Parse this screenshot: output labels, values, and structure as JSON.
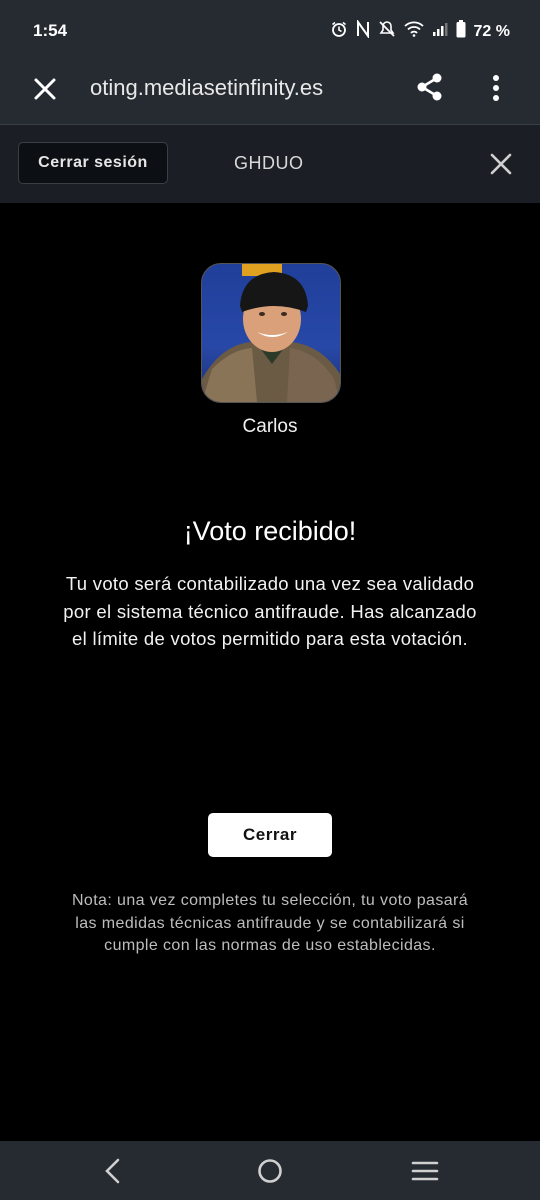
{
  "status_bar": {
    "time": "1:54",
    "battery_percent": "72 %",
    "icons": [
      "alarm-icon",
      "nfc-icon",
      "mute-icon",
      "wifi-icon",
      "signal-icon",
      "battery-icon"
    ]
  },
  "browser": {
    "url": "oting.mediasetinfinity.es",
    "icons": [
      "close-icon",
      "share-icon",
      "more-vert-icon"
    ]
  },
  "site_header": {
    "logout_label": "Cerrar sesión",
    "program": "GHDUO"
  },
  "candidate": {
    "name": "Carlos"
  },
  "confirmation": {
    "title": "¡Voto recibido!",
    "message": "Tu voto será contabilizado una vez sea validado por el sistema técnico antifraude. Has alcanzado el límite de votos permitido para esta votación.",
    "close_label": "Cerrar",
    "note": "Nota: una vez completes tu selección, tu voto pasará las medidas técnicas antifraude y se contabilizará si cumple con las normas de uso establecidas."
  },
  "nav_bar": {
    "icons": [
      "back-icon",
      "home-icon",
      "recent-apps-icon"
    ]
  },
  "colors": {
    "chrome": "#262b32",
    "site_header": "#1b1f25",
    "background": "#000000",
    "button": "#ffffff"
  }
}
